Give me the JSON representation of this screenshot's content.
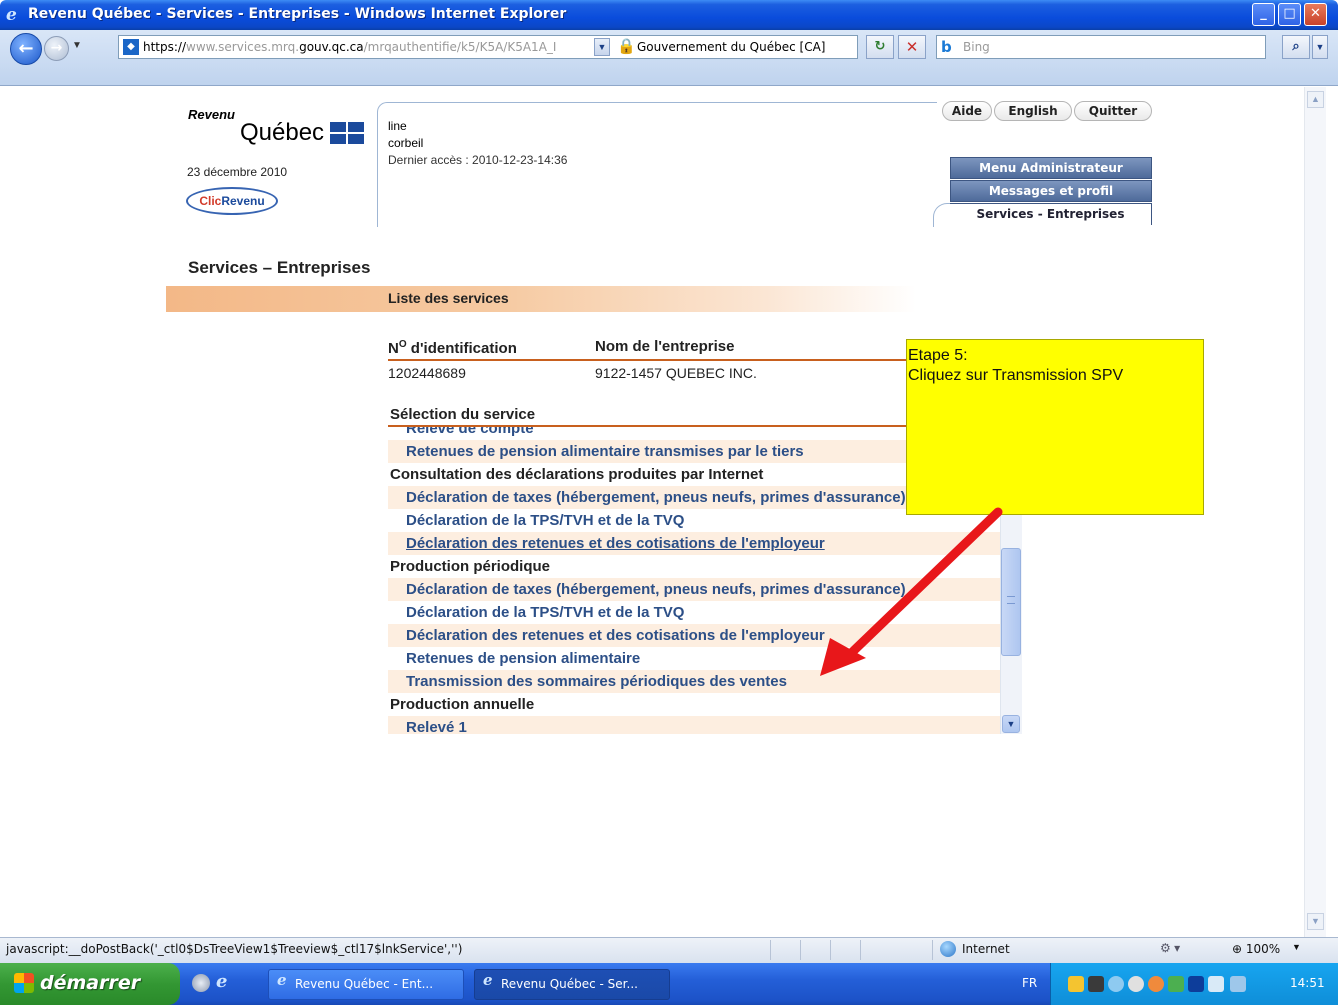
{
  "window": {
    "title": "Revenu Québec - Services - Entreprises - Windows Internet Explorer",
    "min_label": "_",
    "max_label": "□",
    "close_label": "✕"
  },
  "addressbar": {
    "url_proto": "https://",
    "url_pre": "www.services.mrq.",
    "url_domain": "gouv.qc.ca",
    "url_path": "/mrqauthentifie/k5/K5A/K5A1A_I",
    "certificate": "Gouvernement du Québec [CA]",
    "search_placeholder": "Bing"
  },
  "header": {
    "logo_revenu": "Revenu",
    "logo_quebec": "Québec",
    "date": "23 décembre 2010",
    "clic_part1": "Clic",
    "clic_part2": "Revenu",
    "user_first": "line",
    "user_last": "corbeil",
    "last_access": "Dernier accès : 2010-12-23-14:36",
    "links": {
      "aide": "Aide",
      "english": "English",
      "quitter": "Quitter"
    },
    "tabs": {
      "admin": "Menu Administrateur",
      "messages": "Messages et profil",
      "services": "Services - Entreprises"
    }
  },
  "main": {
    "page_title": "Services – Entreprises",
    "section_label": "Liste des services",
    "col_id": "d'identification",
    "col_id_prefix": "N",
    "col_id_sup": "O",
    "col_name": "Nom de l'entreprise",
    "id_value": "1202448689",
    "name_value": "9122-1457 QUEBEC INC.",
    "selection_heading": "Sélection du service",
    "tree": [
      {
        "label": "Relevé de compte",
        "kind": "svc",
        "shade": false
      },
      {
        "label": "Retenues de pension alimentaire transmises par le tiers",
        "kind": "svc",
        "shade": true
      },
      {
        "label": "Consultation des déclarations produites par Internet",
        "kind": "cat",
        "shade": false
      },
      {
        "label": "Déclaration de taxes (hébergement, pneus neufs, primes d'assurance)",
        "kind": "svc",
        "shade": true
      },
      {
        "label": "Déclaration de la TPS/TVH et de la TVQ",
        "kind": "svc",
        "shade": false
      },
      {
        "label": "Déclaration des retenues et des cotisations de l'employeur",
        "kind": "svc",
        "shade": true,
        "underline": true
      },
      {
        "label": "Production périodique",
        "kind": "cat",
        "shade": false
      },
      {
        "label": "Déclaration de taxes (hébergement, pneus neufs, primes d'assurance)",
        "kind": "svc",
        "shade": true
      },
      {
        "label": "Déclaration de la TPS/TVH et de la TVQ",
        "kind": "svc",
        "shade": false
      },
      {
        "label": "Déclaration des retenues et des cotisations de l'employeur",
        "kind": "svc",
        "shade": true
      },
      {
        "label": "Retenues de pension alimentaire",
        "kind": "svc",
        "shade": false
      },
      {
        "label": "Transmission des sommaires périodiques des ventes",
        "kind": "svc",
        "shade": true
      },
      {
        "label": "Production annuelle",
        "kind": "cat",
        "shade": false
      },
      {
        "label": "Relevé 1",
        "kind": "svc",
        "shade": true
      }
    ]
  },
  "callout": {
    "line1": "Etape 5:",
    "line2": "Cliquez sur Transmission SPV",
    "arrow_color": "#e8171a",
    "bg_color": "#ffff00"
  },
  "statusbar": {
    "text": "javascript:__doPostBack('_ctl0$DsTreeView1$Treeview$_ctl17$lnkService','')",
    "zone": "Internet",
    "zoom": "100%"
  },
  "taskbar": {
    "start": "démarrer",
    "item1": "Revenu Québec - Ent...",
    "item2": "Revenu Québec - Ser...",
    "lang": "FR",
    "clock": "14:51"
  }
}
